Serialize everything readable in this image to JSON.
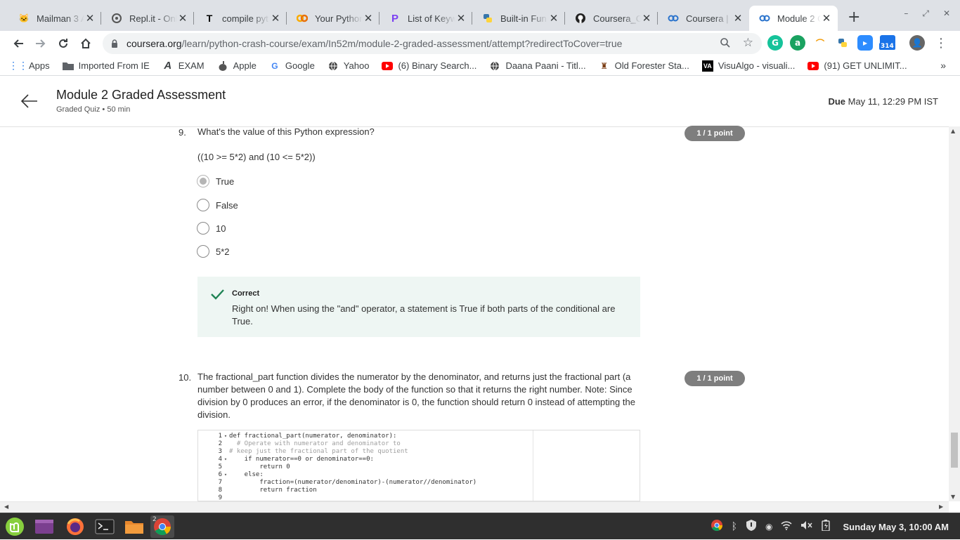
{
  "browser": {
    "tabs": [
      {
        "title": "Mailman 3 A",
        "icon": "mailman-icon"
      },
      {
        "title": "Repl.it - Onl",
        "icon": "replit-icon"
      },
      {
        "title": "compile pyt",
        "icon": "typora-t-icon"
      },
      {
        "title": "Your Pythor",
        "icon": "colab-icon"
      },
      {
        "title": "List of Keyw",
        "icon": "pycharm-p-icon"
      },
      {
        "title": "Built-in Fun",
        "icon": "python-icon"
      },
      {
        "title": "Coursera_C",
        "icon": "github-icon"
      },
      {
        "title": "Coursera | C",
        "icon": "coursera-icon"
      },
      {
        "title": "Module 2 G",
        "icon": "coursera-icon",
        "active": true
      }
    ],
    "new_tab_label": "+",
    "url_host": "coursera.org",
    "url_path": "/learn/python-crash-course/exam/In52m/module-2-graded-assessment/attempt?redirectToCover=true",
    "extension_badge": "314",
    "bookmarks": [
      {
        "label": "Apps",
        "icon": "apps-grid-icon"
      },
      {
        "label": "Imported From IE",
        "icon": "folder-icon"
      },
      {
        "label": "EXAM",
        "icon": "a-logo-icon"
      },
      {
        "label": "Apple",
        "icon": "apple-icon"
      },
      {
        "label": "Google",
        "icon": "google-icon"
      },
      {
        "label": "Yahoo",
        "icon": "yahoo-icon"
      },
      {
        "label": "(6) Binary Search...",
        "icon": "youtube-icon"
      },
      {
        "label": "Daana Paani - Titl...",
        "icon": "globe-icon"
      },
      {
        "label": "Old Forester Sta...",
        "icon": "bookmark-site-icon"
      },
      {
        "label": "VisuAlgo - visuali...",
        "icon": "visualgo-icon"
      },
      {
        "label": "(91) GET UNLIMIT...",
        "icon": "youtube-icon"
      }
    ],
    "bookmarks_overflow": "»"
  },
  "header": {
    "title": "Module 2 Graded Assessment",
    "subtitle": "Graded Quiz • 50 min",
    "due_label": "Due",
    "due_value": "May 11, 12:29 PM IST"
  },
  "question9": {
    "number": "9.",
    "prompt": "What's the value of this Python expression?",
    "expression": "((10 >= 5*2) and (10 <= 5*2))",
    "score": "1 / 1 point",
    "options": [
      "True",
      "False",
      "10",
      "5*2"
    ],
    "selected_index": 0,
    "feedback_title": "Correct",
    "feedback_text": "Right on! When using the \"and\" operator, a statement is True if both parts of the conditional are True."
  },
  "question10": {
    "number": "10.",
    "prompt": "The fractional_part function divides the numerator by the denominator, and returns just the fractional part (a number between 0 and 1). Complete the body of the function so that it returns the right number. Note: Since division by 0 produces an error, if the denominator is 0, the function should return 0 instead of attempting the division.",
    "score": "1 / 1 point",
    "code_lines": [
      {
        "n": "1",
        "fold": true,
        "text": "def fractional_part(numerator, denominator):"
      },
      {
        "n": "2",
        "fold": false,
        "text": "  # Operate with numerator and denominator to"
      },
      {
        "n": "3",
        "fold": false,
        "text": "# keep just the fractional part of the quotient"
      },
      {
        "n": "4",
        "fold": true,
        "text": "    if numerator==0 or denominator==0:"
      },
      {
        "n": "5",
        "fold": false,
        "text": "        return 0"
      },
      {
        "n": "6",
        "fold": true,
        "text": "    else:"
      },
      {
        "n": "7",
        "fold": false,
        "text": "        fraction=(numerator/denominator)-(numerator//denominator)"
      },
      {
        "n": "8",
        "fold": false,
        "text": "        return fraction"
      },
      {
        "n": "9",
        "fold": false,
        "text": ""
      }
    ]
  },
  "taskbar": {
    "workspace_badge": "2",
    "clock": "Sunday May  3, 10:00 AM"
  },
  "colors": {
    "accent_correct": "#1f8354",
    "badge_bg": "#7e7e7e",
    "feedback_bg": "#eef6f3"
  }
}
